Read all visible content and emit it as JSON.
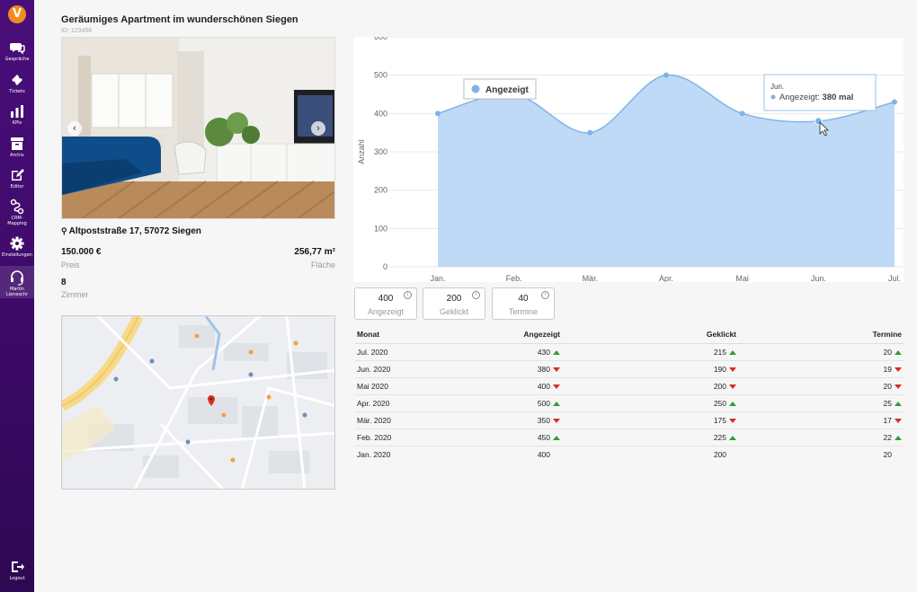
{
  "sidebar": {
    "logo": "V",
    "items": [
      {
        "label": "Gespräche",
        "icon": "chat-bubbles-icon"
      },
      {
        "label": "Tickets",
        "icon": "ticket-icon"
      },
      {
        "label": "KPIs",
        "icon": "bar-chart-icon"
      },
      {
        "label": "Archiv",
        "icon": "archive-box-icon"
      },
      {
        "label": "Editor",
        "icon": "edit-icon"
      },
      {
        "label": "CRM-",
        "label2": "Mapping",
        "icon": "mapping-icon"
      },
      {
        "label": "Einstellungen",
        "icon": "gear-icon"
      },
      {
        "label": "Martin",
        "label2": "Lieneschr",
        "icon": "headset-icon"
      }
    ],
    "logout": "Logout"
  },
  "listing": {
    "title": "Geräumiges Apartment im wunderschönen Siegen",
    "id": "ID: 123456",
    "address": "Altpoststraße 17, 57072 Siegen",
    "price": "150.000 €",
    "price_label": "Preis",
    "area": "256,77 m²",
    "area_label": "Fläche",
    "rooms": "8",
    "rooms_label": "Zimmer"
  },
  "chart_data": {
    "type": "area",
    "categories": [
      "Jan.",
      "Feb.",
      "Mär.",
      "Apr.",
      "Mai",
      "Jun.",
      "Jul."
    ],
    "series": [
      {
        "name": "Angezeigt",
        "values": [
          400,
          450,
          350,
          500,
          400,
          380,
          430
        ]
      }
    ],
    "ylabel": "Anzahl",
    "ylim": [
      0,
      600
    ],
    "yticks": [
      0,
      100,
      200,
      300,
      400,
      500,
      600
    ],
    "grid": true,
    "legend_position": "top-left",
    "color": "#7fb3e8",
    "tooltip": {
      "title": "Jun.",
      "label": "Angezeigt:",
      "value": "380 mal"
    }
  },
  "kpis": [
    {
      "value": "400",
      "label": "Angezeigt"
    },
    {
      "value": "200",
      "label": "Geklickt"
    },
    {
      "value": "40",
      "label": "Termine"
    }
  ],
  "table": {
    "headers": [
      "Monat",
      "Angezeigt",
      "Geklickt",
      "Termine"
    ],
    "rows": [
      {
        "month": "Jul. 2020",
        "shown": "430",
        "shown_t": "up",
        "clicked": "215",
        "clicked_t": "up",
        "dates": "20",
        "dates_t": "up"
      },
      {
        "month": "Jun. 2020",
        "shown": "380",
        "shown_t": "down",
        "clicked": "190",
        "clicked_t": "down",
        "dates": "19",
        "dates_t": "down"
      },
      {
        "month": "Mai 2020",
        "shown": "400",
        "shown_t": "down",
        "clicked": "200",
        "clicked_t": "down",
        "dates": "20",
        "dates_t": "down"
      },
      {
        "month": "Apr. 2020",
        "shown": "500",
        "shown_t": "up",
        "clicked": "250",
        "clicked_t": "up",
        "dates": "25",
        "dates_t": "up"
      },
      {
        "month": "Mär. 2020",
        "shown": "350",
        "shown_t": "down",
        "clicked": "175",
        "clicked_t": "down",
        "dates": "17",
        "dates_t": "down"
      },
      {
        "month": "Feb. 2020",
        "shown": "450",
        "shown_t": "up",
        "clicked": "225",
        "clicked_t": "up",
        "dates": "22",
        "dates_t": "up"
      },
      {
        "month": "Jan. 2020",
        "shown": "400",
        "shown_t": "none",
        "clicked": "200",
        "clicked_t": "none",
        "dates": "20",
        "dates_t": "none"
      }
    ]
  },
  "colors": {
    "sidebar": "#3b0a66",
    "accent": "#f28c1a",
    "chart_fill": "#bcd8f5",
    "chart_line": "#7fb3e8",
    "up": "#2e9e3b",
    "down": "#d62b2b"
  }
}
